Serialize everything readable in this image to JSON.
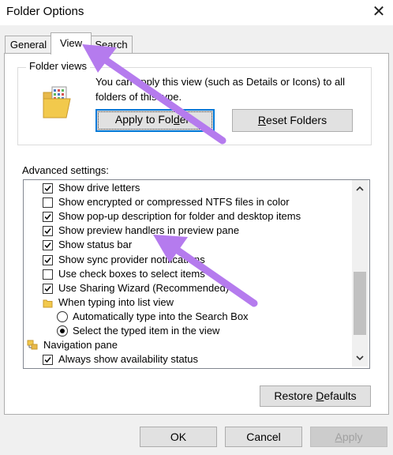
{
  "window": {
    "title": "Folder Options",
    "close_glyph": "✕"
  },
  "tabs": [
    {
      "label": "General",
      "active": false
    },
    {
      "label": "View",
      "active": true
    },
    {
      "label": "Search",
      "active": false
    }
  ],
  "folder_views": {
    "legend": "Folder views",
    "description": "You can apply this view (such as Details or Icons) to all folders of this type.",
    "apply_button": {
      "pre": "Apply to Fol",
      "mnemonic": "d",
      "post": "ers"
    },
    "reset_button": {
      "pre": "",
      "mnemonic": "R",
      "post": "eset Folders"
    },
    "icon": "folder-view-icon"
  },
  "advanced": {
    "label": "Advanced settings:",
    "items": [
      {
        "type": "checkbox",
        "checked": true,
        "label": "Show drive letters"
      },
      {
        "type": "checkbox",
        "checked": false,
        "label": "Show encrypted or compressed NTFS files in color"
      },
      {
        "type": "checkbox",
        "checked": true,
        "label": "Show pop-up description for folder and desktop items"
      },
      {
        "type": "checkbox",
        "checked": true,
        "label": "Show preview handlers in preview pane"
      },
      {
        "type": "checkbox",
        "checked": true,
        "label": "Show status bar"
      },
      {
        "type": "checkbox",
        "checked": true,
        "label": "Show sync provider notifications"
      },
      {
        "type": "checkbox",
        "checked": false,
        "label": "Use check boxes to select items"
      },
      {
        "type": "checkbox",
        "checked": true,
        "label": "Use Sharing Wizard (Recommended)"
      },
      {
        "type": "folder",
        "label": "When typing into list view"
      },
      {
        "type": "radio",
        "checked": false,
        "label": "Automatically type into the Search Box"
      },
      {
        "type": "radio",
        "checked": true,
        "label": "Select the typed item in the view"
      },
      {
        "type": "nav",
        "label": "Navigation pane"
      },
      {
        "type": "checkbox",
        "checked": true,
        "label": "Always show availability status"
      }
    ],
    "restore_button": {
      "pre": "Restore ",
      "mnemonic": "D",
      "post": "efaults"
    }
  },
  "buttons": {
    "ok": "OK",
    "cancel": "Cancel",
    "apply": {
      "pre": "",
      "mnemonic": "A",
      "post": "pply",
      "enabled": false
    }
  },
  "colors": {
    "arrow": "#b57bee",
    "focus_border": "#0078d7",
    "dialog_bg": "#f0f0f0"
  }
}
